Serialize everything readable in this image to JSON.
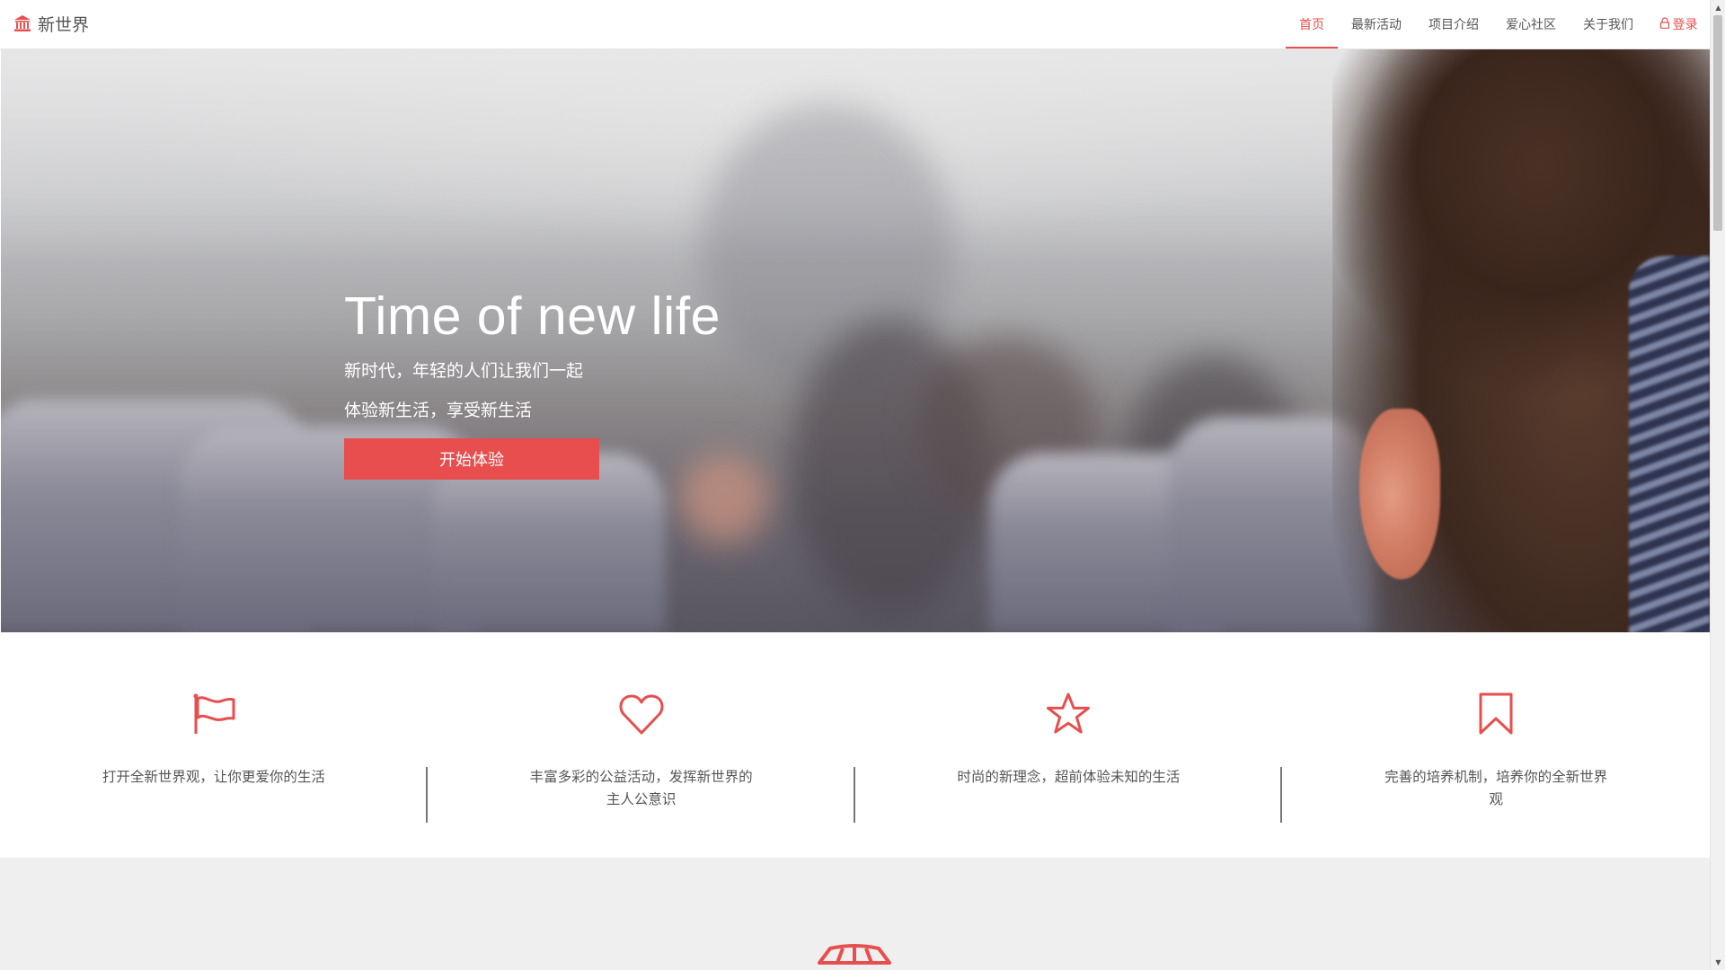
{
  "navbar": {
    "brand": "新世界",
    "items": [
      {
        "label": "首页",
        "active": true
      },
      {
        "label": "最新活动"
      },
      {
        "label": "项目介绍"
      },
      {
        "label": "爱心社区"
      },
      {
        "label": "关于我们"
      }
    ],
    "login_label": "登录"
  },
  "hero": {
    "title": "Time of new life",
    "subtitle_1": "新时代，年轻的人们让我们一起",
    "subtitle_2": "体验新生活，享受新生活",
    "cta_label": "开始体验"
  },
  "features": [
    {
      "icon": "flag-icon",
      "text": "打开全新世界观，让你更爱你的生活"
    },
    {
      "icon": "heart-icon",
      "text": "丰富多彩的公益活动，发挥新世界的主人公意识"
    },
    {
      "icon": "star-icon",
      "text": "时尚的新理念，超前体验未知的生活"
    },
    {
      "icon": "bookmark-icon",
      "text": "完善的培养机制，培养你的全新世界观"
    }
  ],
  "colors": {
    "accent": "#e84e4e",
    "text": "#555555",
    "lower_bg": "#efefef"
  }
}
